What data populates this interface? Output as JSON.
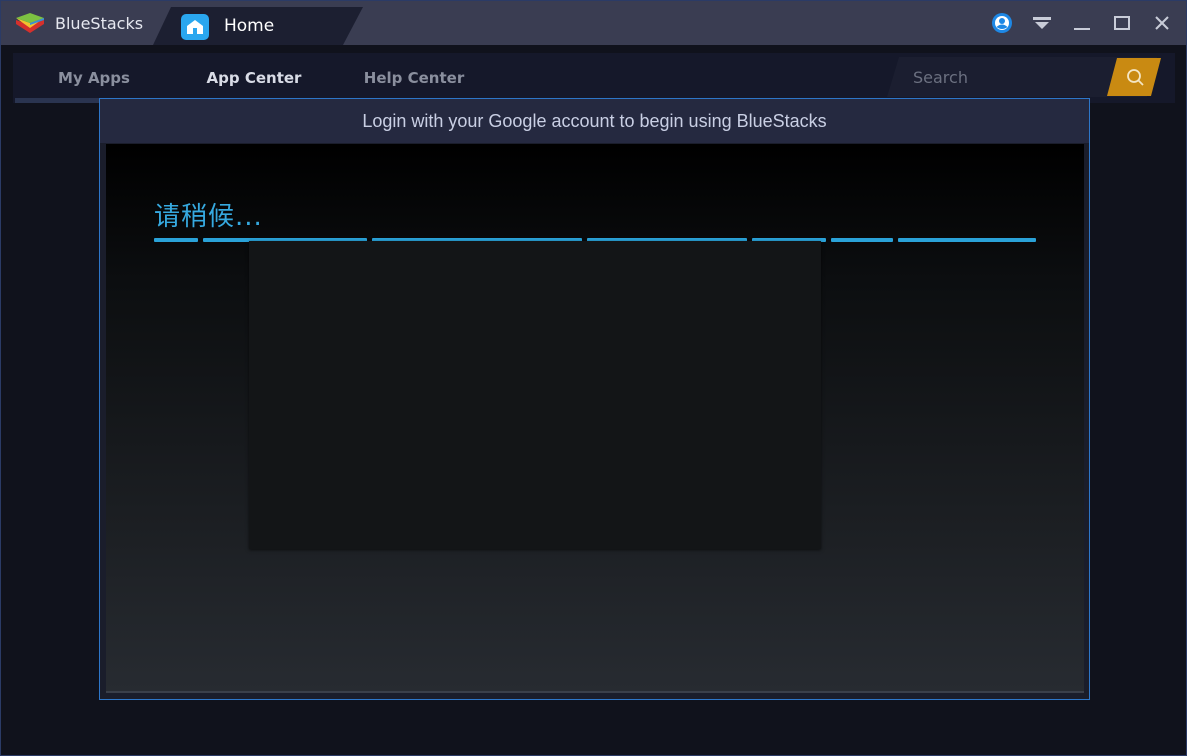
{
  "titlebar": {
    "brand_name": "BlueStacks",
    "home_tab_label": "Home",
    "icons": [
      "bluestacks-logo-icon",
      "home-icon",
      "account-icon",
      "dropdown-menu-icon",
      "minimize-icon",
      "maximize-icon",
      "close-icon"
    ]
  },
  "nav": {
    "tabs": [
      {
        "label": "My Apps",
        "active": false
      },
      {
        "label": "App Center",
        "active": true
      },
      {
        "label": "Help Center",
        "active": false
      }
    ],
    "search": {
      "placeholder": "Search",
      "icon": "search-icon"
    }
  },
  "dialog": {
    "title": "Login with your Google account to begin using BlueStacks",
    "wait_text": "请稍候..."
  },
  "colors": {
    "accent": "#2aa7ef",
    "progress": "#2aa2d8",
    "search_button": "#c98a12",
    "dialog_border": "#2d76c8"
  }
}
